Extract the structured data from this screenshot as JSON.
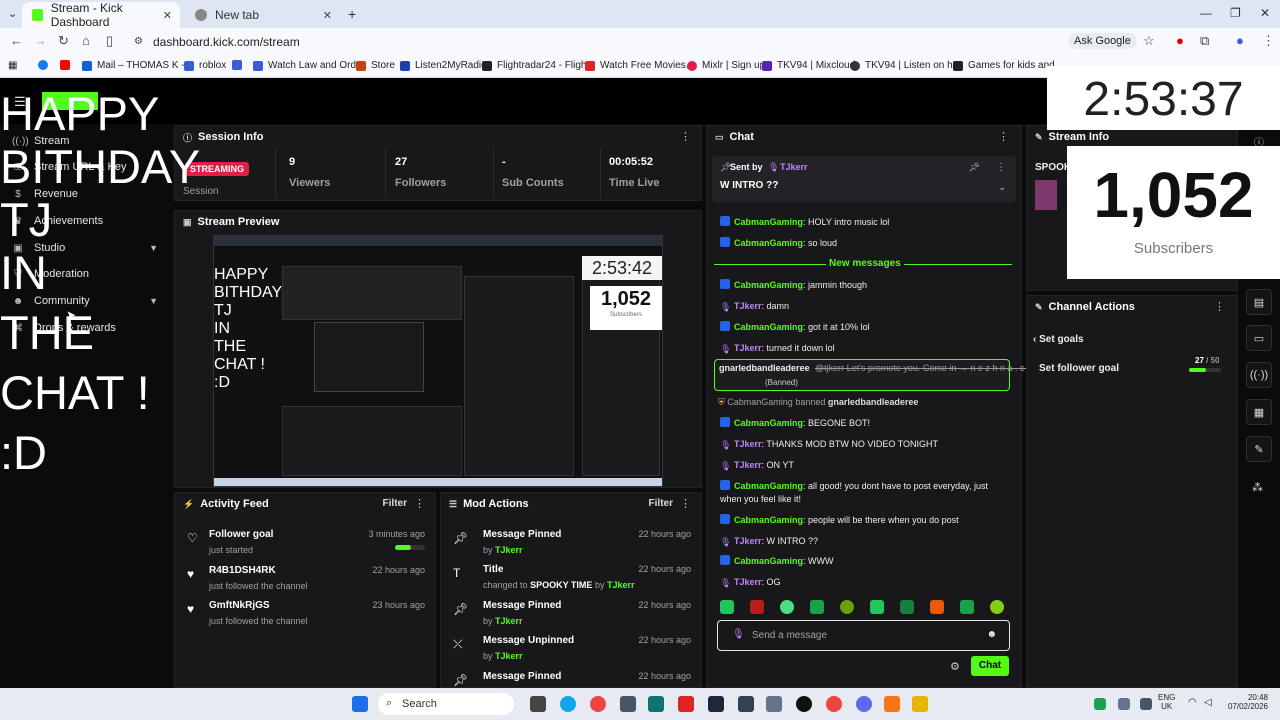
{
  "browser": {
    "tabs": [
      {
        "label": "Stream - Kick Dashboard",
        "active": true
      },
      {
        "label": "New tab",
        "active": false
      }
    ],
    "url": "dashboard.kick.com/stream",
    "ask_google": "Ask Google",
    "bookmarks": [
      {
        "label": "",
        "icon": "facebook-icon",
        "color": "#1877f2"
      },
      {
        "label": "",
        "icon": "youtube-icon",
        "color": "#ff0000"
      },
      {
        "label": "Mail – THOMAS K -...",
        "icon": "mail-icon",
        "color": "#0a64d6"
      },
      {
        "label": "roblox",
        "icon": "bookmark-icon",
        "color": "#3b5bdb"
      },
      {
        "label": "",
        "icon": "bookmark-icon",
        "color": "#3b5bdb"
      },
      {
        "label": "Watch Law and Ord...",
        "icon": "bookmark-icon",
        "color": "#3b5bdb"
      },
      {
        "label": "Store",
        "icon": "store-icon",
        "color": "#c2410c"
      },
      {
        "label": "Listen2MyRadio",
        "icon": "radio-icon",
        "color": "#1e40af"
      },
      {
        "label": "Flightradar24 - Fligh...",
        "icon": "bookmark-icon",
        "color": "#222"
      },
      {
        "label": "Watch Free Movies...",
        "icon": "bookmark-icon",
        "color": "#dc2626"
      },
      {
        "label": "Mixlr | Sign up",
        "icon": "bookmark-icon",
        "color": "#e11d48"
      },
      {
        "label": "TKV94 | Mixcloud",
        "icon": "bookmark-icon",
        "color": "#5b21b6"
      },
      {
        "label": "TKV94 | Listen on h...",
        "icon": "bookmark-icon",
        "color": "#333"
      },
      {
        "label": "Games for kids and...",
        "icon": "bookmark-icon",
        "color": "#222"
      }
    ]
  },
  "overlay": {
    "timer": "2:53:37",
    "sub_count": "1,052",
    "sub_label": "Subscribers",
    "birthday_lines": [
      "HAPPY",
      "BITHDAY",
      "TJ",
      "IN",
      "THE",
      "CHAT !",
      ":D"
    ]
  },
  "sidebar": {
    "items": [
      {
        "label": "Stream",
        "icon": "broadcast-icon",
        "chevron": false
      },
      {
        "label": "Stream URL & Key",
        "icon": "key-icon",
        "chevron": false
      },
      {
        "label": "Revenue",
        "icon": "dollar-icon",
        "chevron": false
      },
      {
        "label": "Achievements",
        "icon": "trophy-icon",
        "chevron": false
      },
      {
        "label": "Studio",
        "icon": "studio-icon",
        "chevron": true
      },
      {
        "label": "Moderation",
        "icon": "shield-icon",
        "chevron": false
      },
      {
        "label": "Community",
        "icon": "users-icon",
        "chevron": true
      },
      {
        "label": "Drops & rewards",
        "icon": "gift-icon",
        "chevron": false
      }
    ]
  },
  "session_info": {
    "title": "Session Info",
    "status": "STREAMING",
    "status_label": "Session",
    "stats": [
      {
        "value": "9",
        "label": "Viewers"
      },
      {
        "value": "27",
        "label": "Followers"
      },
      {
        "value": "-",
        "label": "Sub Counts"
      },
      {
        "value": "00:05:52",
        "label": "Time Live"
      }
    ]
  },
  "stream_preview": {
    "title": "Stream Preview",
    "inner_timer": "2:53:42",
    "inner_subs": "1,052",
    "inner_sub_label": "Subscribers",
    "inner_text": [
      "HAPPY",
      "BITHDAY",
      "TJ",
      "IN",
      "THE",
      "CHAT !",
      ":D"
    ]
  },
  "activity_feed": {
    "title": "Activity Feed",
    "filter": "Filter",
    "items": [
      {
        "title": "Follower goal",
        "sub": "just started",
        "ago": "3 minutes ago",
        "icon": "heart-outline-icon",
        "progress": 0.54
      },
      {
        "title": "R4B1DSH4RK",
        "sub": "just followed the channel",
        "ago": "22 hours ago",
        "icon": "heart-icon"
      },
      {
        "title": "GmftNkRjGS",
        "sub": "just followed the channel",
        "ago": "23 hours ago",
        "icon": "heart-icon"
      }
    ]
  },
  "mod_actions": {
    "title": "Mod Actions",
    "filter": "Filter",
    "items": [
      {
        "title": "Message Pinned",
        "pre": "by",
        "user": "TJkerr",
        "ago": "22 hours ago",
        "icon": "pin-icon"
      },
      {
        "title": "Title",
        "pre": "changed to",
        "target": "SPOOKY TIME",
        "mid": "by",
        "user": "TJkerr",
        "ago": "22 hours ago",
        "icon": "text-icon"
      },
      {
        "title": "Message Pinned",
        "pre": "by",
        "user": "TJkerr",
        "ago": "22 hours ago",
        "icon": "pin-icon"
      },
      {
        "title": "Message Unpinned",
        "pre": "by",
        "user": "TJkerr",
        "ago": "22 hours ago",
        "icon": "unpin-icon"
      },
      {
        "title": "Message Pinned",
        "pre": "",
        "user": "",
        "ago": "22 hours ago",
        "icon": "pin-icon"
      }
    ]
  },
  "chat": {
    "title": "Chat",
    "pinned": {
      "sent_by": "Sent by",
      "user": "TJkerr",
      "text": "W INTRO ??"
    },
    "new_messages": "New messages",
    "messages": [
      {
        "user": "CabmanGaming",
        "text": "HOLY intro music lol",
        "role": "mod"
      },
      {
        "user": "CabmanGaming",
        "text": "so loud",
        "role": "mod"
      },
      {
        "user": "CabmanGaming",
        "text": "jammin though",
        "role": "mod"
      },
      {
        "user": "TJkerr",
        "text": "damn",
        "role": "broadcaster"
      },
      {
        "user": "CabmanGaming",
        "text": "got it at 10% lol",
        "role": "mod"
      },
      {
        "user": "TJkerr",
        "text": "turned it down lol",
        "role": "broadcaster"
      },
      {
        "user": "CabmanGaming",
        "text": "BEGONE BOT!",
        "role": "mod"
      },
      {
        "user": "TJkerr",
        "text": "THANKS MOD BTW NO VIDEO TONIGHT",
        "role": "broadcaster"
      },
      {
        "user": "TJkerr",
        "text": "ON YT",
        "role": "broadcaster"
      },
      {
        "user": "CabmanGaming",
        "text": "all good! you dont have to post everyday, just when you feel like it!",
        "role": "mod"
      },
      {
        "user": "CabmanGaming",
        "text": "people will be there when you do post",
        "role": "mod"
      },
      {
        "user": "TJkerr",
        "text": "W INTRO ??",
        "role": "broadcaster"
      },
      {
        "user": "CabmanGaming",
        "text": "WWW",
        "role": "mod"
      },
      {
        "user": "TJkerr",
        "text": "OG",
        "role": "broadcaster"
      }
    ],
    "banned_msg": {
      "user": "gnarledbandleaderee",
      "text": "@tjkerr Let's promote you. Come in → n e z h n a . c o m",
      "tag": "(Banned)"
    },
    "ban_event": {
      "mod": "CabmanGaming",
      "verb": "banned",
      "target": "gnarledbandleaderee"
    },
    "input_placeholder": "Send a message",
    "send_label": "Chat"
  },
  "stream_info": {
    "title": "Stream Info",
    "category": "SPOOK"
  },
  "channel_actions": {
    "title": "Channel Actions",
    "back_label": "Set goals",
    "goal_label": "Set follower goal",
    "goal_current": "27",
    "goal_total": "/ 50",
    "goal_fraction": 0.54
  },
  "taskbar": {
    "search": "Search",
    "lang": "ENG",
    "region": "UK",
    "time": "20:48",
    "date": "07/02/2026"
  },
  "colors": {
    "kick_green": "#53fc18",
    "purple": "#c084fc",
    "panel": "#18181b"
  }
}
